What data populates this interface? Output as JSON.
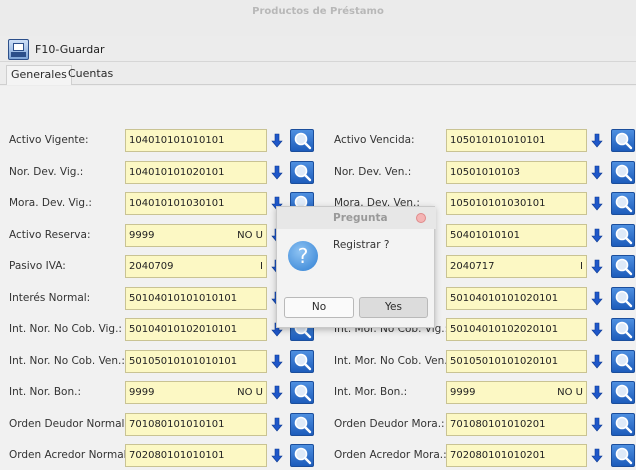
{
  "window": {
    "title": "Productos de Préstamo"
  },
  "toolbar": {
    "save_label": "F10-Guardar"
  },
  "tabs": [
    {
      "label": "Generales"
    },
    {
      "label": "Cuentas"
    }
  ],
  "left": [
    {
      "label": "Activo Vigente:",
      "value": "104010101010101",
      "suffix": ""
    },
    {
      "label": "Nor. Dev. Vig.:",
      "value": "104010101020101",
      "suffix": ""
    },
    {
      "label": "Mora. Dev. Vig.:",
      "value": "104010101030101",
      "suffix": ""
    },
    {
      "label": "Activo Reserva:",
      "value": "9999",
      "suffix": "NO U"
    },
    {
      "label": "Pasivo IVA:",
      "value": "2040709",
      "suffix": "I"
    },
    {
      "label": "Interés Normal:",
      "value": "50104010101010101",
      "suffix": ""
    },
    {
      "label": "Int. Nor. No Cob. Vig.:",
      "value": "50104010102010101",
      "suffix": ""
    },
    {
      "label": "Int. Nor. No Cob. Ven.:",
      "value": "50105010101010101",
      "suffix": ""
    },
    {
      "label": "Int. Nor. Bon.:",
      "value": "9999",
      "suffix": "NO U"
    },
    {
      "label": "Orden Deudor Normal:",
      "value": "701080101010101",
      "suffix": ""
    },
    {
      "label": "Orden Acredor Normal:",
      "value": "702080101010101",
      "suffix": ""
    }
  ],
  "right": [
    {
      "label": "Activo Vencida:",
      "value": "105010101010101",
      "suffix": ""
    },
    {
      "label": "Nor. Dev. Ven.:",
      "value": "10501010103",
      "suffix": ""
    },
    {
      "label": "Mora. Dev. Ven.:",
      "value": "105010101030101",
      "suffix": ""
    },
    {
      "label": "",
      "value": "50401010101",
      "suffix": ""
    },
    {
      "label": "",
      "value": "2040717",
      "suffix": "I"
    },
    {
      "label": "",
      "value": "50104010101020101",
      "suffix": ""
    },
    {
      "label": "Int. Mor. No Cob. Vig.:",
      "value": "50104010102020101",
      "suffix": ""
    },
    {
      "label": "Int. Mor. No Cob. Ven.:",
      "value": "50105010101020101",
      "suffix": ""
    },
    {
      "label": "Int. Mor. Bon.:",
      "value": "9999",
      "suffix": "NO U"
    },
    {
      "label": "Orden Deudor Mora.:",
      "value": "701080101010201",
      "suffix": ""
    },
    {
      "label": "Orden Acredor Mora.:",
      "value": "702080101010201",
      "suffix": ""
    }
  ],
  "dialog": {
    "title": "Pregunta",
    "message": "Registrar ?",
    "no_label": "No",
    "yes_label": "Yes"
  },
  "colors": {
    "field_bg": "#fcf8c4",
    "accent_blue": "#1d5cbb"
  }
}
